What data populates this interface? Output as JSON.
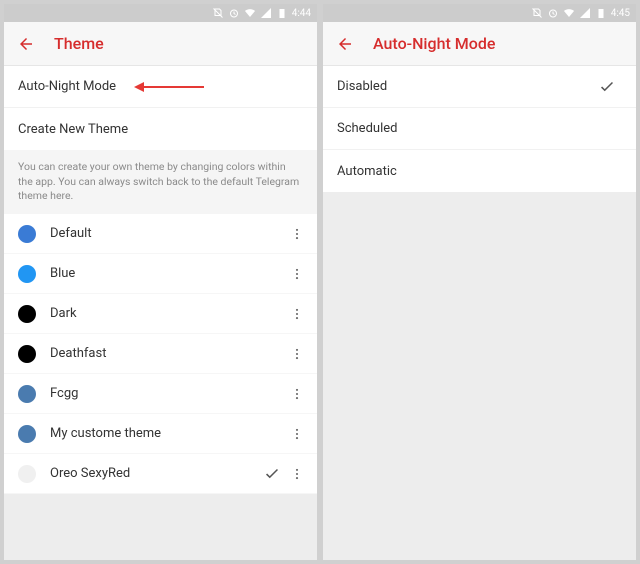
{
  "status": {
    "time_left": "4:44",
    "time_right": "4:45"
  },
  "left": {
    "title": "Theme",
    "rows": {
      "auto_night": "Auto-Night Mode",
      "create_theme": "Create New Theme"
    },
    "info": "You can create your own theme by changing colors within the app. You can always switch back to the default Telegram theme here.",
    "themes": [
      {
        "name": "Default",
        "color": "#3a7bd5",
        "selected": false
      },
      {
        "name": "Blue",
        "color": "#2196f3",
        "selected": false
      },
      {
        "name": "Dark",
        "color": "#000000",
        "selected": false
      },
      {
        "name": "Deathfast",
        "color": "#000000",
        "selected": false
      },
      {
        "name": "Fcgg",
        "color": "#4a7baf",
        "selected": false
      },
      {
        "name": "My custome theme",
        "color": "#4a7baf",
        "selected": false
      },
      {
        "name": "Oreo SexyRed",
        "color": "#f0f0f0",
        "selected": true
      }
    ]
  },
  "right": {
    "title": "Auto-Night Mode",
    "options": [
      {
        "label": "Disabled",
        "selected": true
      },
      {
        "label": "Scheduled",
        "selected": false
      },
      {
        "label": "Automatic",
        "selected": false
      }
    ]
  }
}
